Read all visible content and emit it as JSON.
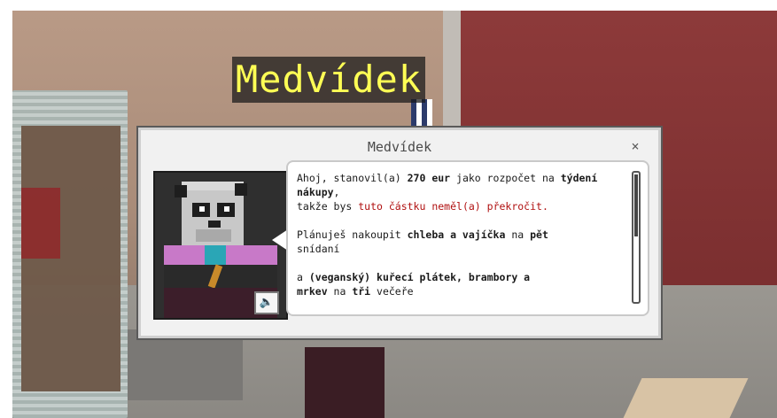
{
  "npc_nametag": "Medvídek",
  "dialog": {
    "title": "Medvídek",
    "close_icon": "×",
    "mute_icon": "speaker-mute",
    "message": {
      "l1a": "Ahoj, stanovil(a) ",
      "l1b": "270 eur",
      "l1c": " jako rozpočet na ",
      "l1d": "týdení",
      "l2": "nákupy",
      "l2b": ",",
      "l3a": "takže bys ",
      "l3b": "tuto částku neměl(a) překročit.",
      "l4a": "Plánuješ nakoupit ",
      "l4b": "chleba a vajíčka",
      "l4c": " na ",
      "l4d": "pět",
      "l5": "snídaní",
      "l6a": "a ",
      "l6b": "(veganský) kuřecí plátek, brambory a",
      "l7a": "mrkev",
      "l7b": " na ",
      "l7c": "tři",
      "l7d": " večeře"
    }
  },
  "colors": {
    "nametag_text": "#ffff55",
    "highlight_red": "#b01010"
  }
}
